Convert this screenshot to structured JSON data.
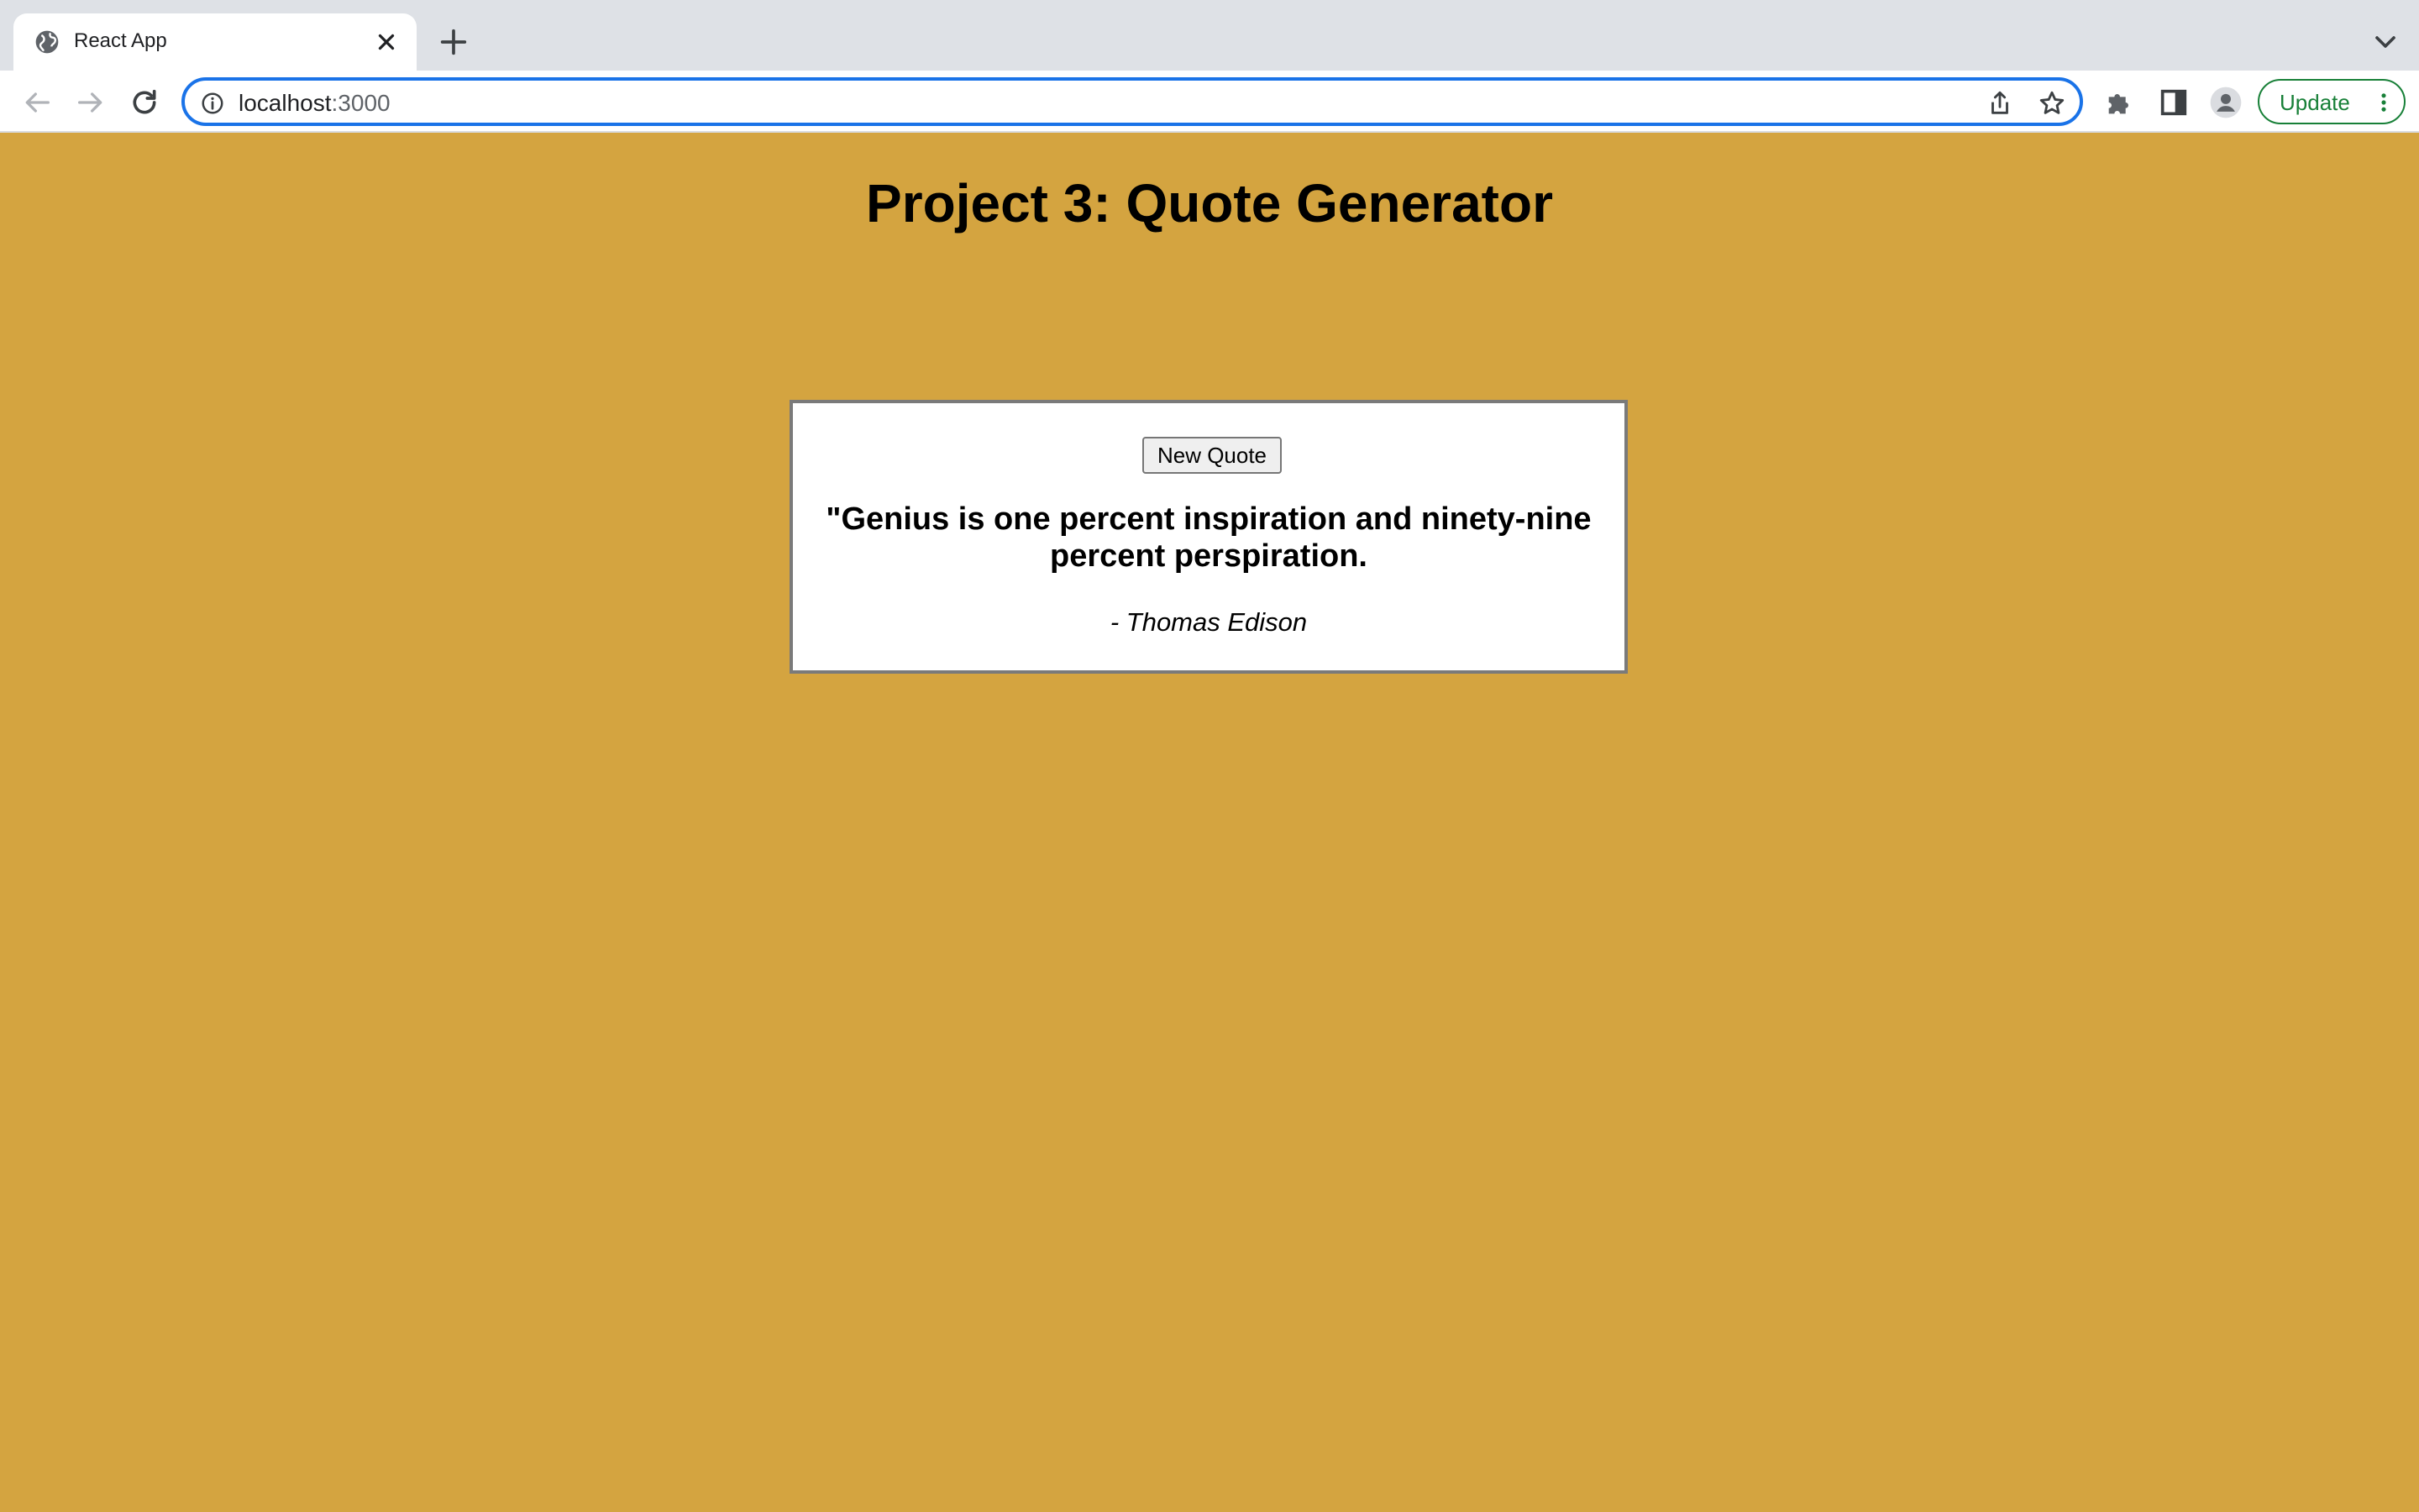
{
  "browser": {
    "tab_title": "React App",
    "url_host": "localhost",
    "url_port": ":3000",
    "update_label": "Update",
    "accent_color": "#1a73e8",
    "update_color": "#188038"
  },
  "page": {
    "title": "Project 3: Quote Generator",
    "background_color": "#d4a440",
    "new_quote_label": "New Quote",
    "quote": "\"Genius is one percent inspiration and ninety-nine percent perspiration.",
    "author": "- Thomas Edison"
  },
  "icons": {
    "favicon": "globe-icon",
    "tab_close": "close-icon",
    "new_tab": "plus-icon",
    "tab_search": "chevron-down-icon",
    "back": "arrow-left-icon",
    "forward": "arrow-right-icon",
    "reload": "reload-icon",
    "site_info": "info-icon",
    "share": "share-icon",
    "bookmark": "star-icon",
    "extensions": "puzzle-icon",
    "side_panel": "side-panel-icon",
    "profile": "profile-icon",
    "menu": "kebab-menu-icon"
  }
}
